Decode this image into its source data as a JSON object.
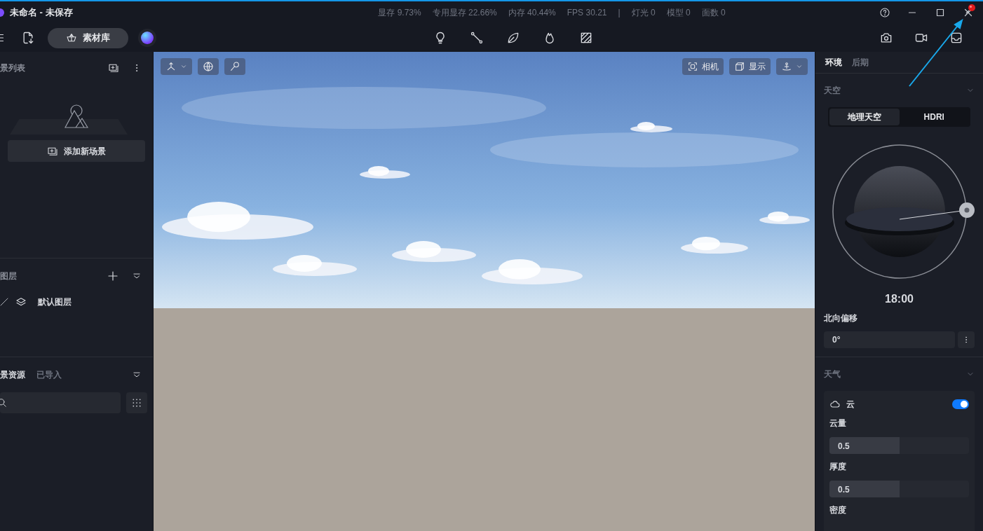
{
  "window": {
    "title": "未命名 - 未保存"
  },
  "stats": [
    "显存 9.73%",
    "专用显存 22.66%",
    "内存 40.44%",
    "FPS 30.21",
    "|",
    "灯光 0",
    "模型 0",
    "面数 0"
  ],
  "toolbar": {
    "library_button": "素材库"
  },
  "scene_list": {
    "title": "景列表",
    "add_button": "添加新场景"
  },
  "layers": {
    "title": "图层",
    "items": [
      {
        "label": "默认图层"
      }
    ]
  },
  "assets": {
    "tabs": [
      {
        "label": "景资源",
        "selected": true
      },
      {
        "label": "已导入",
        "selected": false
      }
    ]
  },
  "viewport": {
    "camera_button": "相机",
    "display_button": "显示"
  },
  "right_panel": {
    "tabs": [
      {
        "label": "环境",
        "selected": true
      },
      {
        "label": "后期",
        "selected": false
      }
    ],
    "sky": {
      "title": "天空",
      "modes": [
        {
          "label": "地理天空",
          "selected": true
        },
        {
          "label": "HDRI",
          "selected": false
        }
      ],
      "time": "18:00",
      "north_label": "北向偏移",
      "north_value": "0°"
    },
    "weather": {
      "title": "天气",
      "cloud": {
        "label": "云",
        "on": true
      },
      "sliders": [
        {
          "label": "云量",
          "value": "0.5",
          "level": 0.5
        },
        {
          "label": "厚度",
          "value": "0.5",
          "level": 0.5
        }
      ],
      "next_label": "密度"
    }
  }
}
